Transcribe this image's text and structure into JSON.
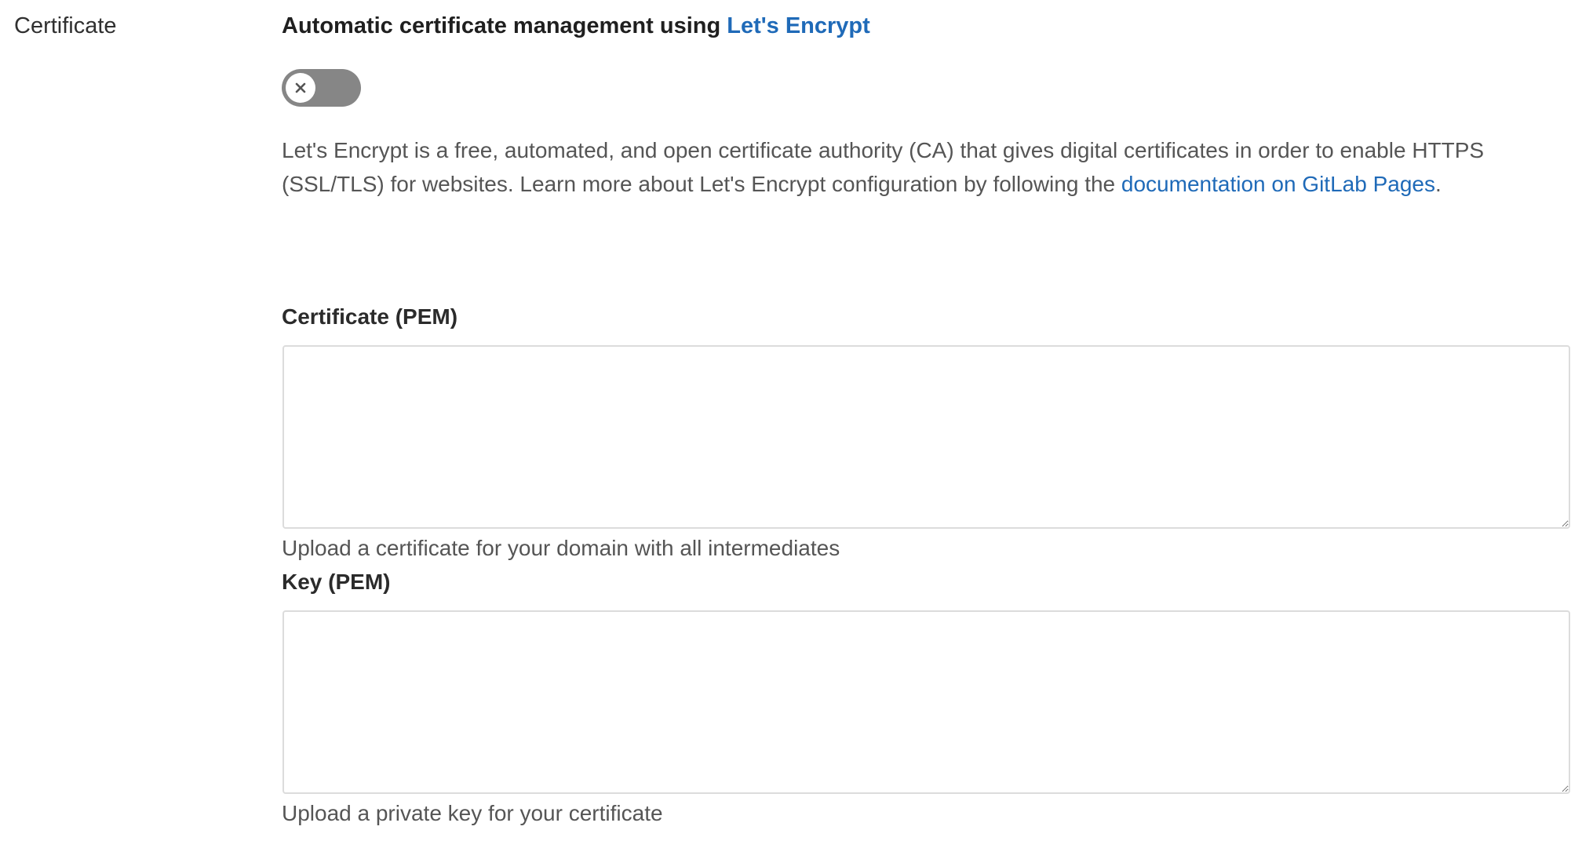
{
  "section": {
    "label": "Certificate"
  },
  "lets_encrypt": {
    "heading_prefix": "Automatic certificate management using ",
    "heading_link": "Let's Encrypt",
    "toggle_state": "off",
    "description_text": "Let's Encrypt is a free, automated, and open certificate authority (CA) that gives digital certificates in order to enable HTTPS (SSL/TLS) for websites. Learn more about Let's Encrypt configuration by following the ",
    "description_link": "documentation on GitLab Pages",
    "description_suffix": "."
  },
  "certificate_field": {
    "label": "Certificate (PEM)",
    "value": "",
    "help": "Upload a certificate for your domain with all intermediates"
  },
  "key_field": {
    "label": "Key (PEM)",
    "value": "",
    "help": "Upload a private key for your certificate"
  },
  "colors": {
    "link": "#1f6ab8",
    "toggle_off": "#868686",
    "divider": "#e3e3e3",
    "border": "#dcdcdc"
  }
}
